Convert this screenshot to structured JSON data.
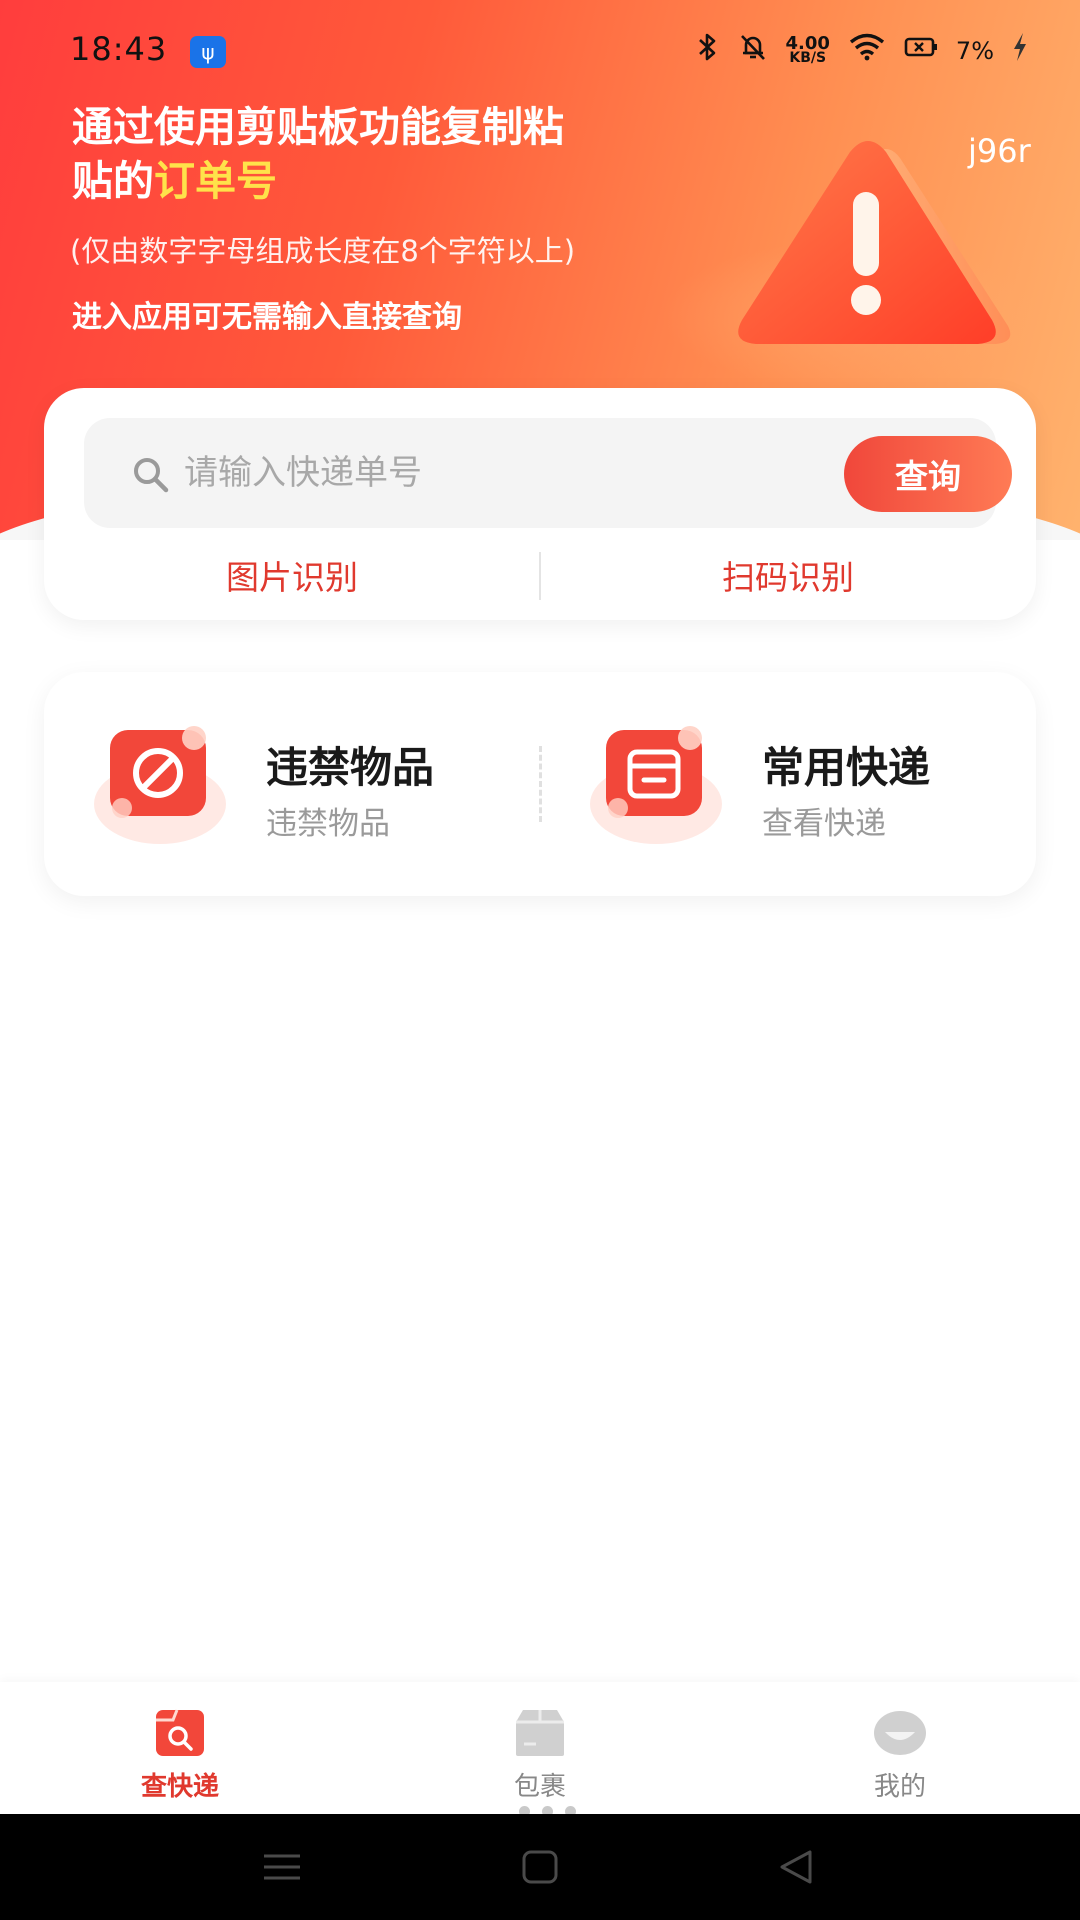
{
  "status_bar": {
    "time": "18:43",
    "usb_icon": "usb-icon",
    "net_speed_value": "4.00",
    "net_speed_unit": "KB/S",
    "battery": "7%",
    "icons": [
      "bluetooth-icon",
      "mute-icon",
      "wifi-icon",
      "battery-icon",
      "charging-icon"
    ]
  },
  "hero": {
    "title_line1": "通过使用剪贴板功能复制粘",
    "title_line2_prefix": "贴的",
    "title_line2_highlight": "订单号",
    "subtitle": "(仅由数字字母组成长度在8个字符以上)",
    "subtitle2": "进入应用可无需输入直接查询",
    "code": "j96r",
    "colors": {
      "accent": "#ff4a3d",
      "highlight": "#ffe24a"
    }
  },
  "search": {
    "placeholder": "请输入快递单号",
    "value": "",
    "button_label": "查询",
    "image_recognition": "图片识别",
    "scan_recognition": "扫码识别"
  },
  "features": [
    {
      "title": "违禁物品",
      "subtitle": "违禁物品",
      "icon": "prohibited-icon"
    },
    {
      "title": "常用快递",
      "subtitle": "查看快递",
      "icon": "archive-box-icon"
    }
  ],
  "tabbar": {
    "tabs": [
      {
        "label": "查快递",
        "icon": "search-parcel-icon",
        "active": true
      },
      {
        "label": "包裹",
        "icon": "package-icon",
        "active": false
      },
      {
        "label": "我的",
        "icon": "profile-icon",
        "active": false
      }
    ]
  },
  "system_nav": [
    "menu-icon",
    "home-icon",
    "back-icon"
  ]
}
